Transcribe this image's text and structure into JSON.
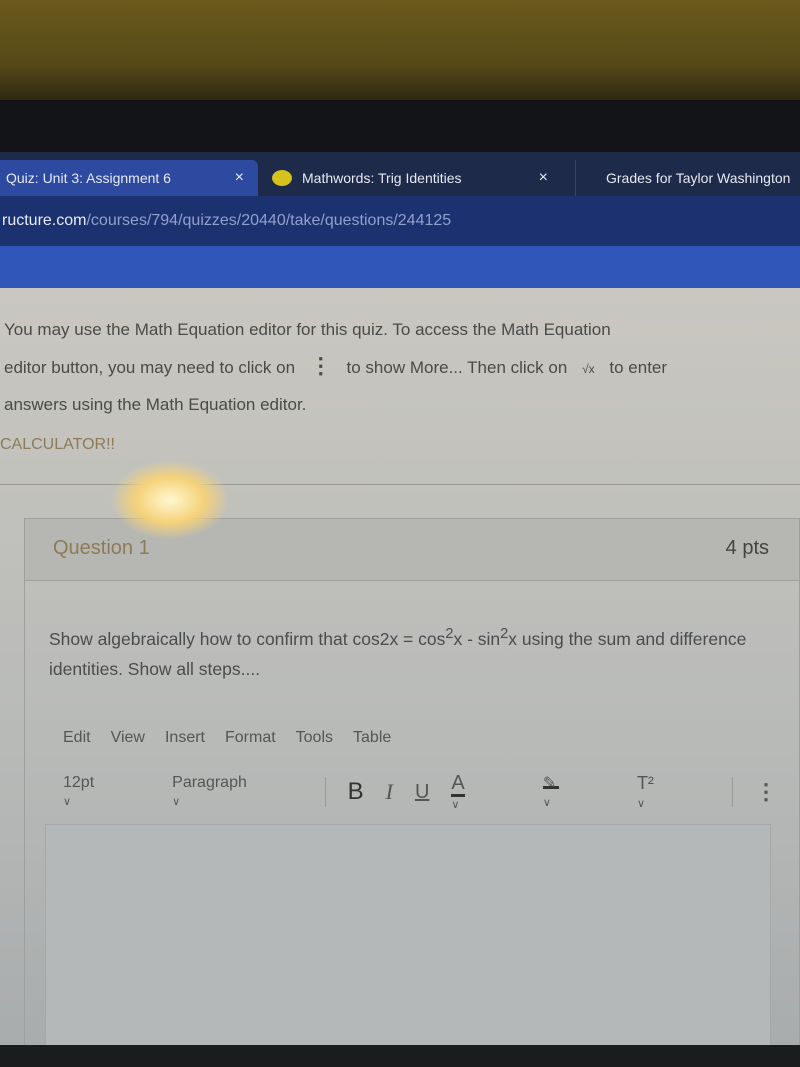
{
  "browser": {
    "tabs": [
      {
        "label": "Quiz: Unit 3: Assignment 6",
        "active": true
      },
      {
        "label": "Mathwords: Trig Identities",
        "active": false
      },
      {
        "label": "Grades for Taylor Washington",
        "active": false
      }
    ],
    "close_glyph": "×",
    "url_domain": "ructure.com",
    "url_path": "/courses/794/quizzes/20440/take/questions/244125"
  },
  "instructions": {
    "line1": "You may use the Math Equation editor for this quiz. To access the Math Equation",
    "line2a": "editor button, you may need to click on",
    "more_glyph": "⋮",
    "line2b": "to show More... Then click on",
    "sqrt_glyph": "√x",
    "line2c": "to enter",
    "line3": "answers using the Math Equation editor.",
    "calculator": "CALCULATOR!!"
  },
  "question": {
    "title": "Question 1",
    "points": "4 pts",
    "text_a": "Show algebraically how to confirm that cos2x = cos",
    "text_b": "x - sin",
    "text_c": "x using the sum and difference identities. Show all steps....",
    "sup": "2"
  },
  "editor": {
    "menu": [
      "Edit",
      "View",
      "Insert",
      "Format",
      "Tools",
      "Table"
    ],
    "font_size": "12pt",
    "block": "Paragraph",
    "bold": "B",
    "italic": "I",
    "underline": "U",
    "color": "A",
    "superscript": "T²",
    "more": "⋮",
    "chevron": "∨"
  },
  "colors": {
    "tab_active": "#2d4aa0",
    "nav": "#2f56b8",
    "question_title": "#8d7b57"
  }
}
